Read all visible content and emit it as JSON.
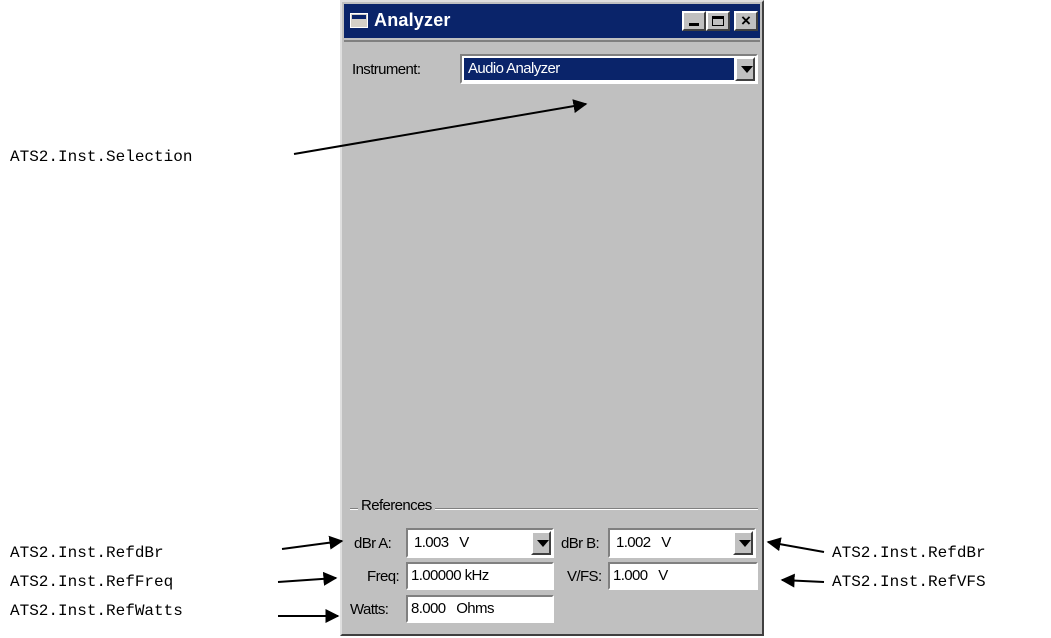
{
  "window": {
    "title": "Analyzer",
    "controls": {
      "minimize": "minimize",
      "maximize": "maximize",
      "close": "×"
    }
  },
  "instrument": {
    "label": "Instrument:",
    "selected": "Audio Analyzer"
  },
  "references": {
    "group_label": "References",
    "dbr_a": {
      "label": "dBr A:",
      "value": "1.003   V"
    },
    "dbr_b": {
      "label": "dBr B:",
      "value": "1.002   V"
    },
    "freq": {
      "label": "Freq:",
      "value": "1.00000 kHz"
    },
    "vfs": {
      "label": "V/FS:",
      "value": "1.000   V"
    },
    "watts": {
      "label": "Watts:",
      "value": "8.000   Ohms"
    }
  },
  "callouts": {
    "selection": "ATS2.Inst.Selection",
    "refdbr_left": "ATS2.Inst.RefdBr",
    "reffreq": "ATS2.Inst.RefFreq",
    "refwatts": "ATS2.Inst.RefWatts",
    "refdbr_right": "ATS2.Inst.RefdBr",
    "refvfs": "ATS2.Inst.RefVFS"
  }
}
